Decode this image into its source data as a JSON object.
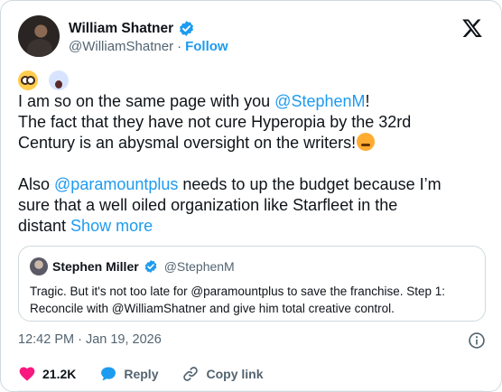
{
  "author": {
    "name": "William Shatner",
    "handle": "@WilliamShatner",
    "separator": "·",
    "follow_label": "Follow"
  },
  "tweet": {
    "line1_pre": "I am so on the same page with you ",
    "line1_mention": "@StephenM",
    "line1_post": "!",
    "line2": "The fact that they have not cure Hyperopia by the 32rd",
    "line3": "Century is an abysmal oversight on the writers!",
    "line4_mention": "@paramountplus",
    "line4_pre": "Also ",
    "line4_post": " needs to up the budget because I’m",
    "line5": "sure that a well oiled organization like Starfleet in the",
    "line6_pre": "distant ",
    "show_more": "Show more"
  },
  "quote": {
    "name": "Stephen Miller",
    "handle": "@StephenM",
    "line1": "Tragic. But it's not too late for @paramountplus to save the franchise. Step 1:",
    "line2": "Reconcile with @WilliamShatner and give him total creative control."
  },
  "timestamp": "12:42 PM · Jan 19, 2026",
  "actions": {
    "likes": "21.2K",
    "reply": "Reply",
    "copy_link": "Copy link"
  },
  "colors": {
    "accent": "#1d9bf0",
    "like": "#f91880",
    "secondary_text": "#536471",
    "border": "#cfd9de"
  },
  "icons": [
    "verified-badge-icon",
    "x-logo-icon",
    "info-icon",
    "heart-icon",
    "reply-bubble-icon",
    "link-icon"
  ]
}
